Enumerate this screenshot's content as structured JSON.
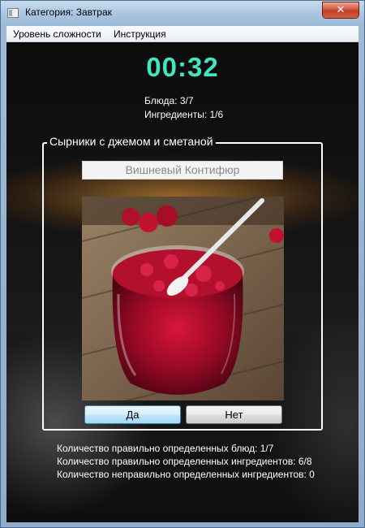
{
  "window": {
    "title": "Категория: Завтрак",
    "close_symbol": "✕"
  },
  "menu": {
    "items": [
      "Уровень сложности",
      "Инструкция"
    ]
  },
  "timer": "00:32",
  "stats": {
    "dishes": "Блюда: 3/7",
    "ingredients": "Ингредиенты: 1/6"
  },
  "dish": {
    "name": "Сырники с джемом и сметаной",
    "ingredient_guess": "Вишневый Контифюр",
    "image_icon": "jam-jar-photo"
  },
  "buttons": {
    "yes": "Да",
    "no": "Нет"
  },
  "results": [
    "Количество правильно определенных блюд: 1/7",
    "Количество правильно определенных ингредиентов: 6/8",
    "Количество неправильно определенных ингредиентов: 0"
  ],
  "colors": {
    "timer": "#3fe6c0",
    "background": "#111111",
    "close_button": "#c43c24"
  }
}
